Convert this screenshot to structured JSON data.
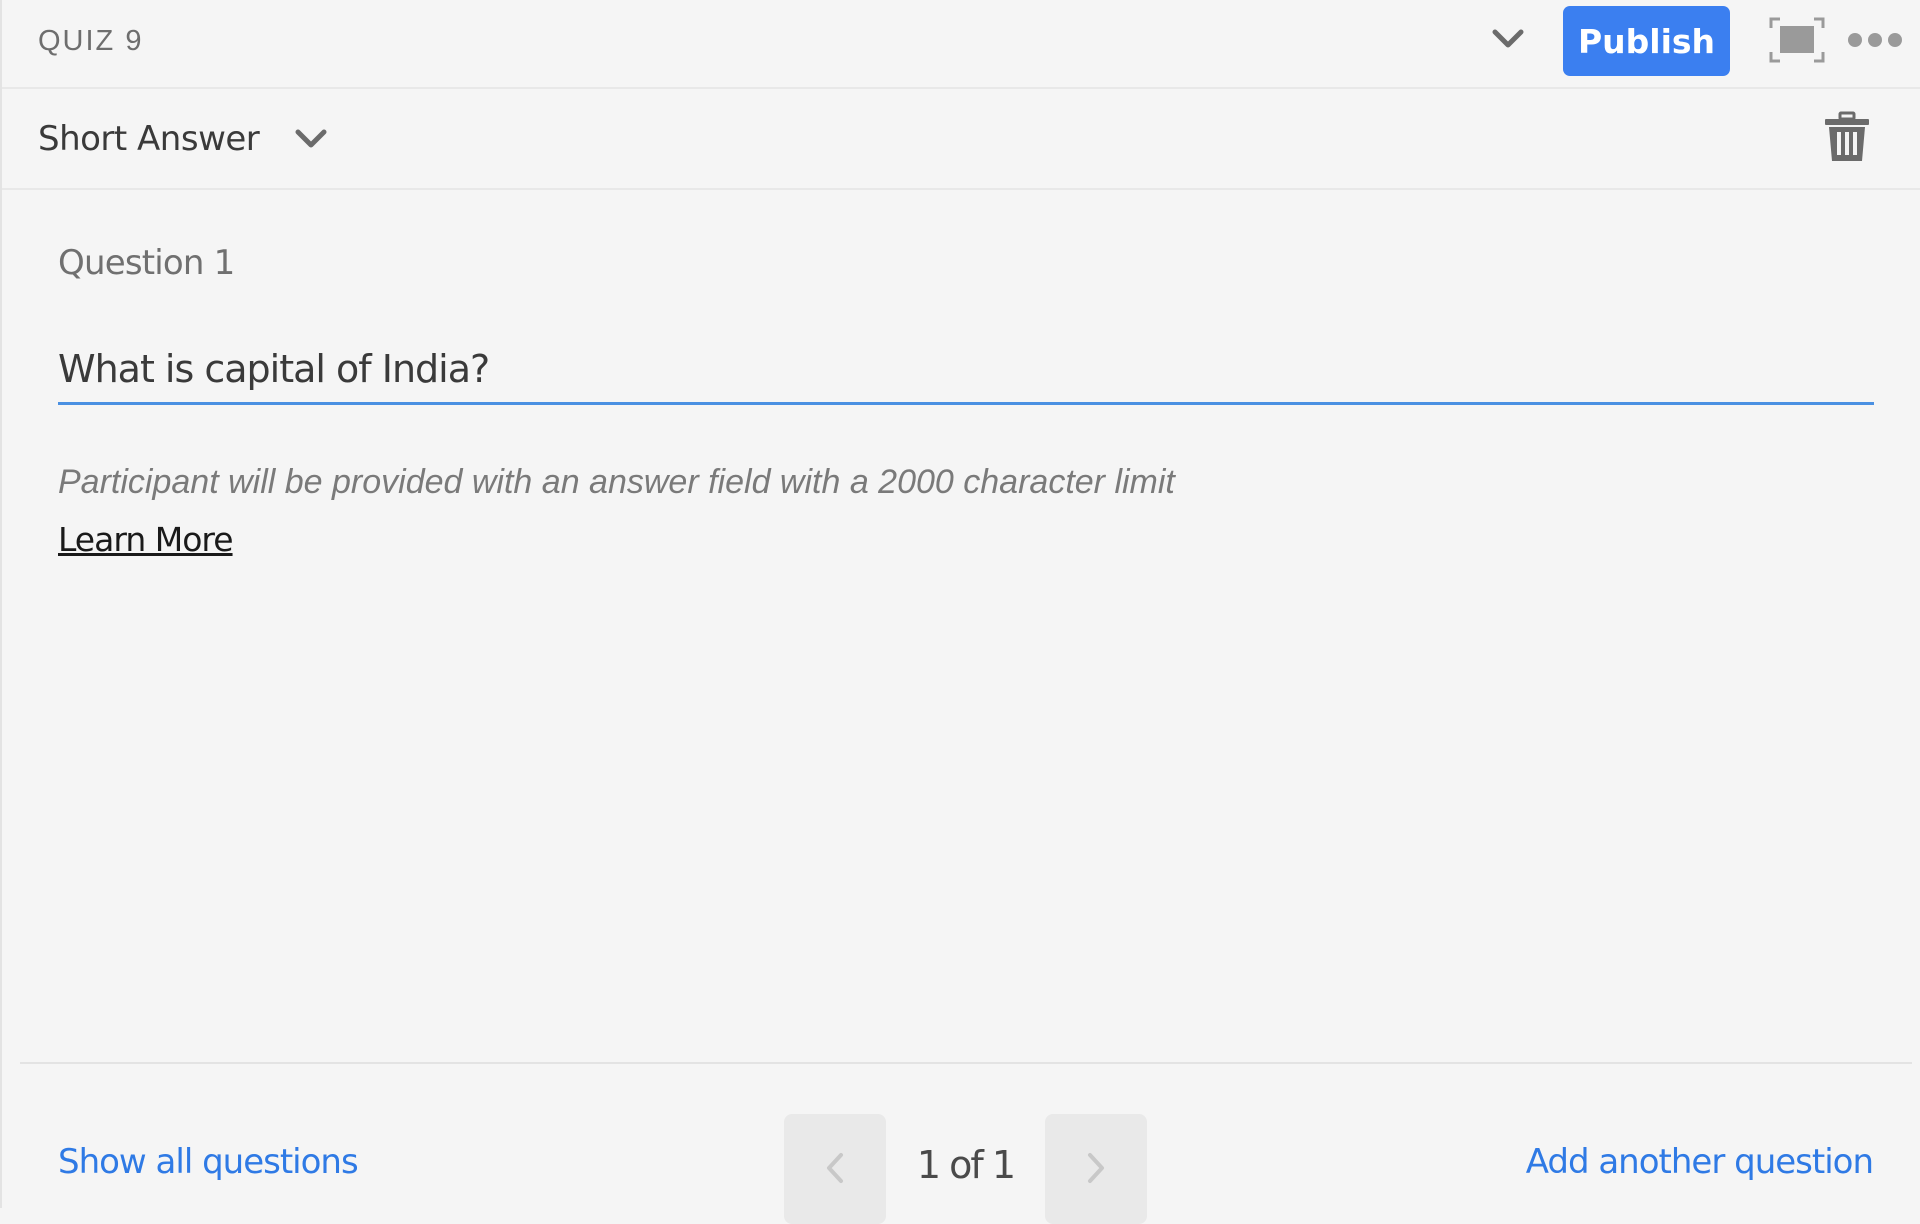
{
  "header": {
    "title": "QUIZ 9",
    "publish_label": "Publish",
    "icons": {
      "collapse": "chevron-down-icon",
      "fullscreen": "fullscreen-icon",
      "more": "more-options-icon"
    }
  },
  "question_type": {
    "selected": "Short Answer",
    "dropdown_icon": "chevron-down-icon",
    "delete_icon": "trash-icon"
  },
  "question": {
    "label": "Question 1",
    "value": "What is capital of India?",
    "helper_text": "Participant will be provided with an answer field with a 2000 character limit",
    "learn_more_label": "Learn More"
  },
  "footer": {
    "show_all_label": "Show all questions",
    "pagination": "1 of 1",
    "prev_icon": "chevron-left-icon",
    "next_icon": "chevron-right-icon",
    "add_question_label": "Add another question"
  },
  "colors": {
    "accent": "#3b7ff0",
    "link": "#2f7ae5",
    "input_underline": "#4a90e2",
    "background": "#f5f5f5"
  }
}
